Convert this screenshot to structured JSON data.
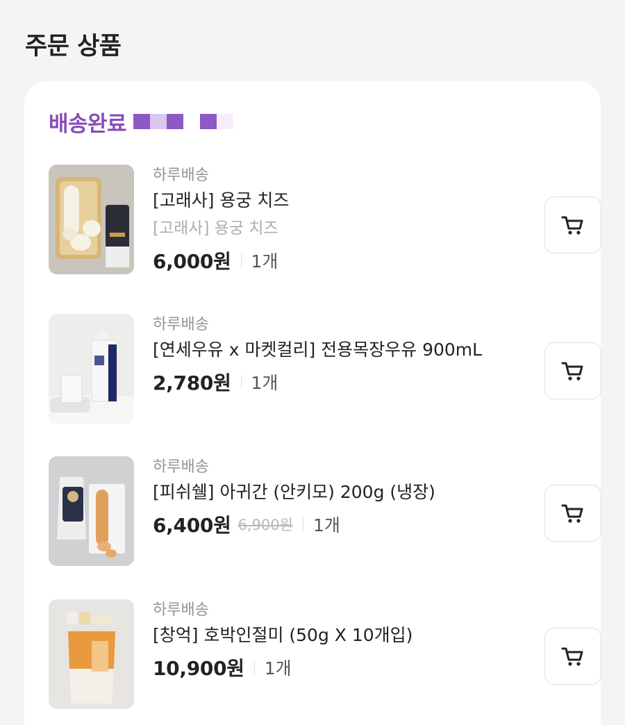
{
  "page": {
    "title": "주문 상품"
  },
  "order": {
    "status": "배송완료",
    "mosaic_colors": [
      "#8c59c5",
      "#d9c7ee",
      "#8c59c5",
      "#ffffff",
      "#8c59c5",
      "#f6effa"
    ]
  },
  "items": [
    {
      "delivery": "하루배송",
      "name": "[고래사] 용궁 치즈",
      "option": "[고래사] 용궁 치즈",
      "price": "6,000원",
      "original_price": "",
      "quantity": "1개",
      "icon": "cart-icon"
    },
    {
      "delivery": "하루배송",
      "name": "[연세우유 x 마켓컬리] 전용목장우유 900mL",
      "option": "",
      "price": "2,780원",
      "original_price": "",
      "quantity": "1개",
      "icon": "cart-icon"
    },
    {
      "delivery": "하루배송",
      "name": "[피쉬쉘] 아귀간 (안키모) 200g (냉장)",
      "option": "",
      "price": "6,400원",
      "original_price": "6,900원",
      "quantity": "1개",
      "icon": "cart-icon"
    },
    {
      "delivery": "하루배송",
      "name": "[창억] 호박인절미 (50g X 10개입)",
      "option": "",
      "price": "10,900원",
      "original_price": "",
      "quantity": "1개",
      "icon": "cart-icon"
    }
  ]
}
